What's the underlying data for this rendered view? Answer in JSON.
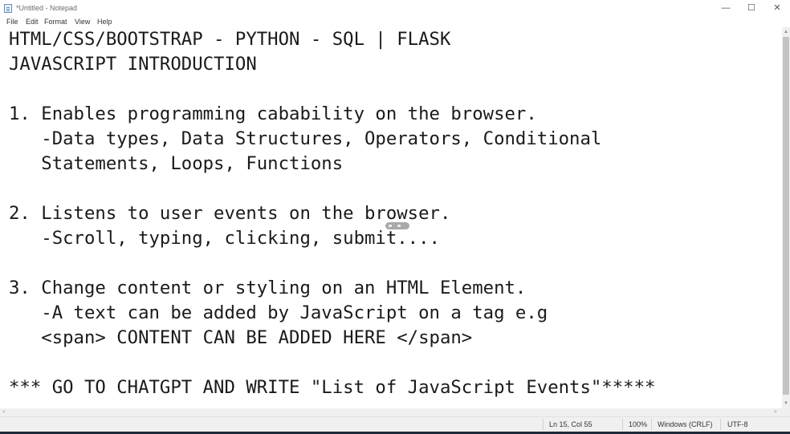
{
  "window": {
    "title": "*Untitled - Notepad",
    "controls": {
      "minimize": "—",
      "maximize": "☐",
      "close": "✕"
    }
  },
  "menu": [
    "File",
    "Edit",
    "Format",
    "View",
    "Help"
  ],
  "editor": {
    "lines": [
      "HTML/CSS/BOOTSTRAP - PYTHON - SQL | FLASK",
      "JAVASCRIPT INTRODUCTION",
      "",
      "1. Enables programming cabability on the browser.",
      "   -Data types, Data Structures, Operators, Conditional",
      "   Statements, Loops, Functions",
      "",
      "2. Listens to user events on the browser.",
      "   -Scroll, typing, clicking, submit....",
      "",
      "3. Change content or styling on an HTML Element.",
      "   -A text can be added by JavaScript on a tag e.g",
      "   <span> CONTENT CAN BE ADDED HERE </span>",
      "",
      "*** GO TO CHATGPT AND WRITE \"List of JavaScript Events\"*****"
    ]
  },
  "statusbar": {
    "position": "Ln 15, Col 55",
    "zoom": "100%",
    "line_ending": "Windows (CRLF)",
    "encoding": "UTF-8"
  },
  "icons": {
    "app": "notepad-icon",
    "scroll_up": "▲",
    "scroll_down": "▼",
    "scroll_left": "<",
    "scroll_right": ">"
  }
}
